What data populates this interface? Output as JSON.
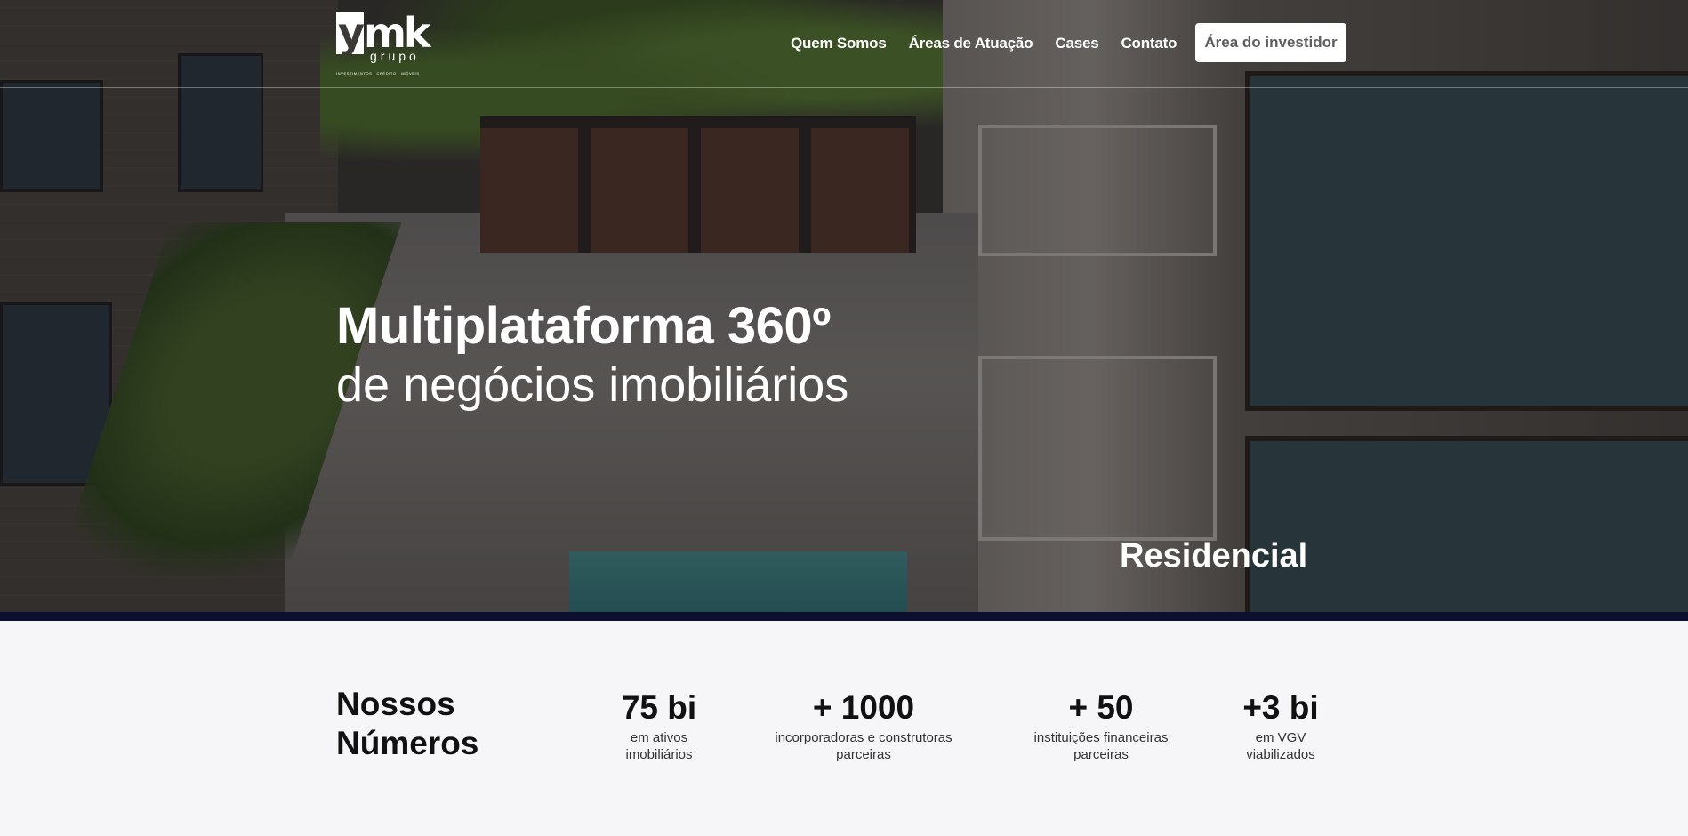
{
  "logo": {
    "mark": "mk",
    "mark_initial": "y",
    "grupo": "grupo",
    "tagline": "INVESTIMENTOS | CRÉDITO | IMÓVEIS"
  },
  "nav": {
    "links": [
      "Quem Somos",
      "Áreas de Atuação",
      "Cases",
      "Contato"
    ],
    "investor_button": "Área do investidor"
  },
  "hero": {
    "title": "Multiplataforma 360º",
    "subtitle": "de negócios imobiliários",
    "category": "Residencial"
  },
  "numbers": {
    "title": "Nossos Números",
    "stats": [
      {
        "value": "75 bi",
        "label": "em ativos imobiliários"
      },
      {
        "value": "+ 1000",
        "label": "incorporadoras e construtoras parceiras"
      },
      {
        "value": "+ 50",
        "label": "instituições financeiras parceiras"
      },
      {
        "value": "+3 bi",
        "label": "em VGV viabilizados"
      }
    ]
  }
}
